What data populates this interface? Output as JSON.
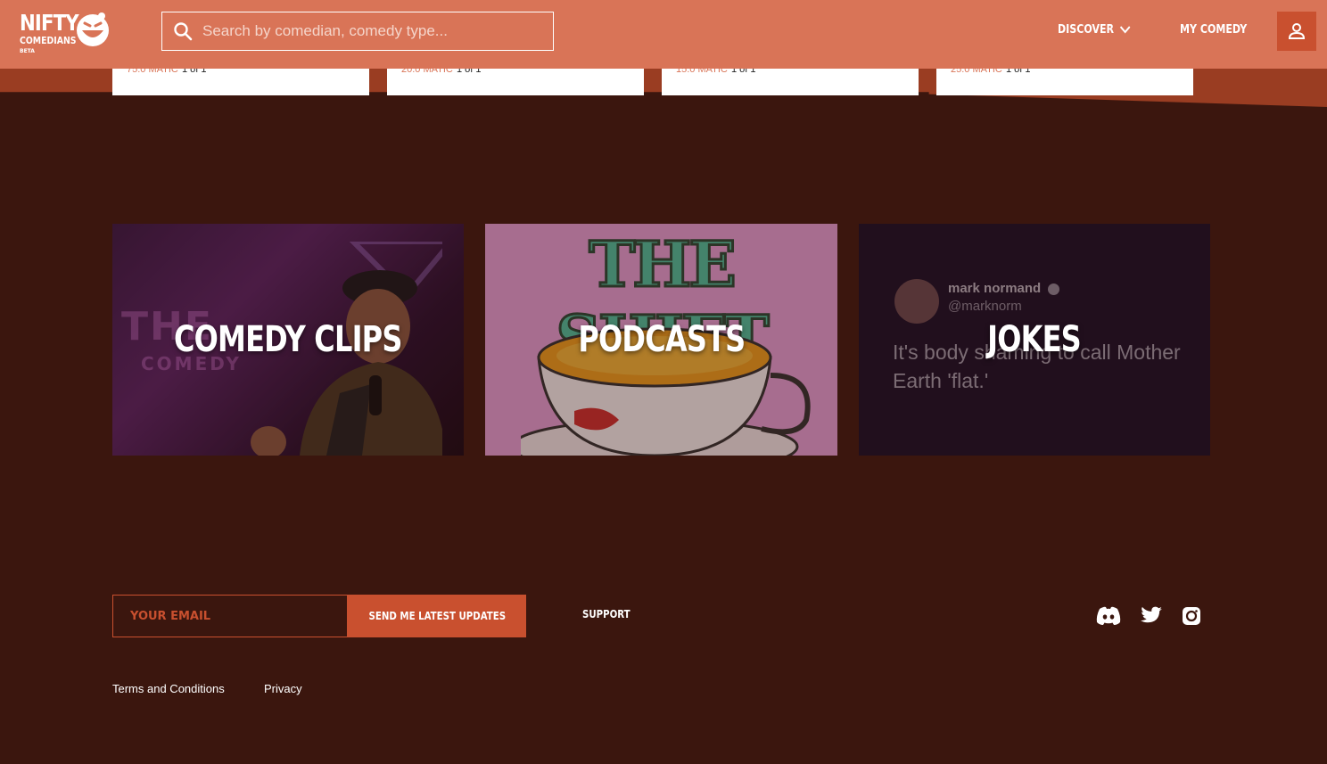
{
  "header": {
    "logo": {
      "line1": "NIFTY",
      "line2": "COMEDIANS",
      "tag": "BETA"
    },
    "search": {
      "placeholder": "Search by comedian, comedy type..."
    },
    "nav": {
      "discover": "DISCOVER",
      "my_comedy": "MY COMEDY"
    }
  },
  "peek_cards": [
    {
      "price": "75.0 MATIC",
      "edition": "1 of 1"
    },
    {
      "price": "20.0 MATIC",
      "edition": "1 of 1"
    },
    {
      "price": "15.0 MATIC",
      "edition": "1 of 1"
    },
    {
      "price": "25.0 MATIC",
      "edition": "1 of 1"
    }
  ],
  "categories": [
    {
      "label": "COMEDY CLIPS",
      "neon_text": "THE",
      "neon_sub": "COMEDY"
    },
    {
      "label": "PODCASTS",
      "poster_title": "THE SHIFT"
    },
    {
      "label": "JOKES",
      "tweet": {
        "name": "mark normand",
        "handle": "@marknorm",
        "text": "It's body shaming to call Mother Earth 'flat.'"
      }
    }
  ],
  "footer": {
    "email_placeholder": "YOUR EMAIL",
    "send_label": "SEND ME LATEST UPDATES",
    "support": "SUPPORT",
    "terms": "Terms and Conditions",
    "privacy": "Privacy"
  },
  "colors": {
    "header_bg": "#d97457",
    "page_bg": "#3b160e",
    "accent": "#c9502f"
  }
}
